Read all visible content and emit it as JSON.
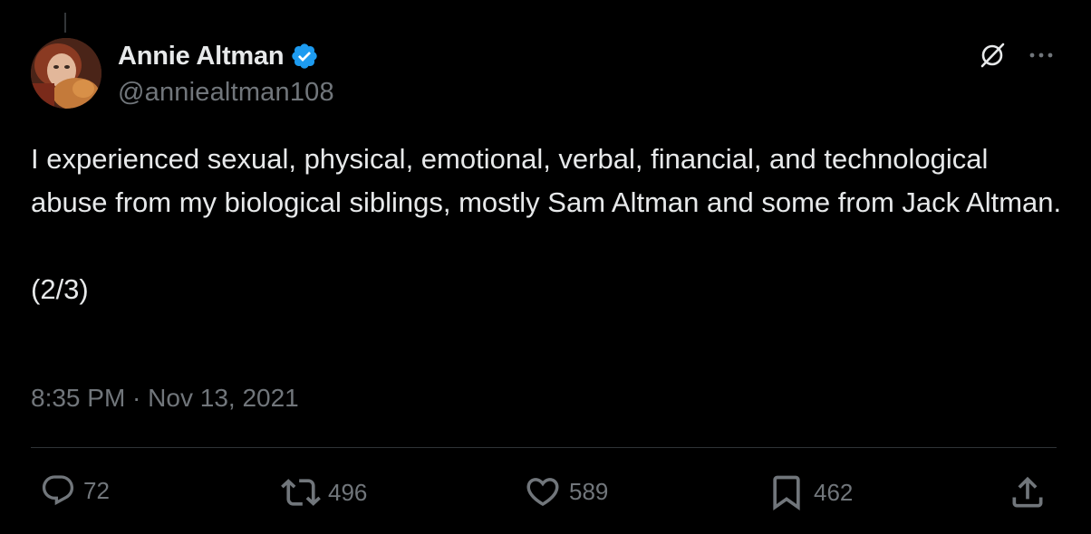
{
  "author": {
    "name": "Annie Altman",
    "handle": "@anniealtman108",
    "verified": true,
    "avatar": "avatar-photo"
  },
  "tweet": {
    "text": "I experienced sexual, physical, emotional, verbal, financial, and technological abuse from my biological siblings, mostly Sam Altman and some from Jack Altman.\n\n(2/3)",
    "time": "8:35 PM",
    "separator": " · ",
    "date": "Nov 13, 2021"
  },
  "top_actions": {
    "grok_icon": "grok-icon",
    "more_icon": "more-icon"
  },
  "actions": {
    "replies": "72",
    "reposts": "496",
    "likes": "589",
    "bookmarks": "462"
  },
  "colors": {
    "background": "#000000",
    "text": "#e7e9ea",
    "secondary": "#71767b",
    "verified": "#1d9bf0",
    "divider": "#2f3336"
  }
}
